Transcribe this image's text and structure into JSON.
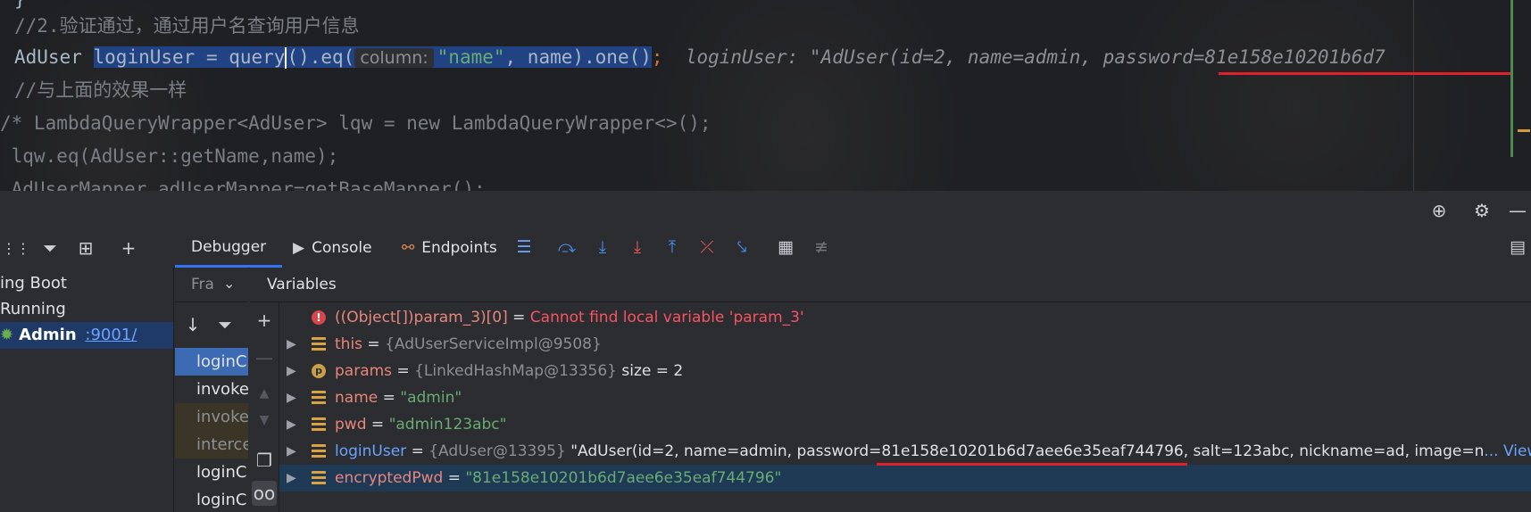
{
  "editor": {
    "line1": "}",
    "line2_comment": "//2.验证通过，通过用户名查询用户信息",
    "line3": {
      "type": "AdUser",
      "var_decl": "loginUser = query",
      "call": "().eq(",
      "hint": "column:",
      "arg_str": "\"name\"",
      "rest": ", name).one()",
      "semicolon": ";",
      "inline_value": "loginUser: \"AdUser(id=2, name=admin, password=81e158e10201b6d7"
    },
    "line4_comment": "//与上面的效果一样",
    "line5": "/* LambdaQueryWrapper<AdUser> lqw = new LambdaQueryWrapper<>();",
    "line6": " lqw.eq(AdUser::getName,name);",
    "line7": " AdUserMapper adUserMapper=getBaseMapper();"
  },
  "debugger": {
    "tabs": [
      {
        "label": "Debugger"
      },
      {
        "label": "Console"
      },
      {
        "label": "Endpoints"
      }
    ],
    "frames_label": "Fra",
    "variables_label": "Variables",
    "left_panel": {
      "items": [
        "ing Boot",
        "Running"
      ],
      "app_name": "Admin",
      "app_port": ":9001/"
    },
    "frames": [
      "loginC",
      "invoke",
      "invoke",
      "interce",
      "loginC",
      "loginC"
    ],
    "variables": [
      {
        "name": "((Object[])param_3)[0]",
        "eq": " = ",
        "value": "Cannot find local variable 'param_3'"
      },
      {
        "name": "this",
        "eq": " = ",
        "value": "{AdUserServiceImpl@9508}"
      },
      {
        "name": "params",
        "eq": " = ",
        "value": "{LinkedHashMap@13356}",
        "extra": "size = 2"
      },
      {
        "name": "name",
        "eq": " = ",
        "value": "\"admin\""
      },
      {
        "name": "pwd",
        "eq": " = ",
        "value": "\"admin123abc\""
      },
      {
        "name": "loginUser",
        "eq": " = ",
        "value": "{AdUser@13395}",
        "extra": "\"AdUser(id=2, name=admin, password=81e158e10201b6d7aee6e35eaf744796, salt=123abc, nickname=ad, image=n",
        "link": "... View"
      },
      {
        "name": "encryptedPwd",
        "eq": " = ",
        "value": "\"81e158e10201b6d7aee6e35eaf744796\""
      }
    ]
  },
  "colors": {
    "accent": "#3574f0",
    "selection": "#214283",
    "underline": "#e0202a",
    "string": "#6aab73",
    "error": "#f75464"
  }
}
